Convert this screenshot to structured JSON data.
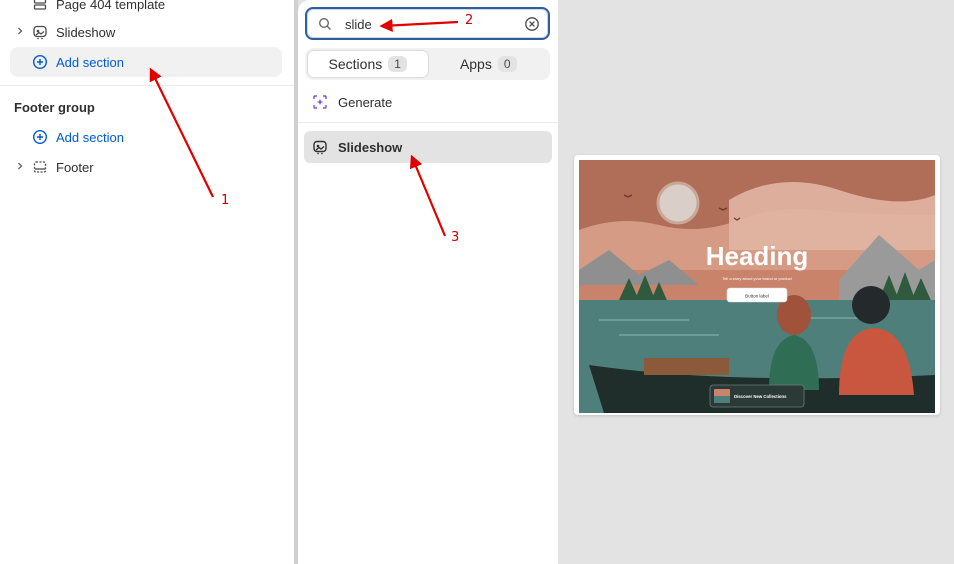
{
  "sidebar": {
    "rows": {
      "page404": "Page 404 template",
      "slideshow": "Slideshow",
      "add_section_1": "Add section",
      "footer_group": "Footer group",
      "add_section_2": "Add section",
      "footer": "Footer"
    }
  },
  "picker": {
    "search": {
      "value": "slide",
      "placeholder": ""
    },
    "tabs": [
      {
        "label": "Sections",
        "count": "1"
      },
      {
        "label": "Apps",
        "count": "0"
      }
    ],
    "generate_label": "Generate",
    "result_label": "Slideshow"
  },
  "preview": {
    "heading": "Heading",
    "subtext": "Tell a story about your brand or product",
    "button": "Button label",
    "bottom_card": "Discover New Collections"
  },
  "annotations": [
    "1",
    "2",
    "3"
  ],
  "colors": {
    "accent": "#005bd3",
    "focus": "#2f5f9b",
    "annotation": "#cc0000"
  },
  "icons": [
    "section-icon",
    "slideshow-icon",
    "chevron-right-icon",
    "plus-circle-icon",
    "search-icon",
    "clear-icon",
    "generate-icon"
  ]
}
